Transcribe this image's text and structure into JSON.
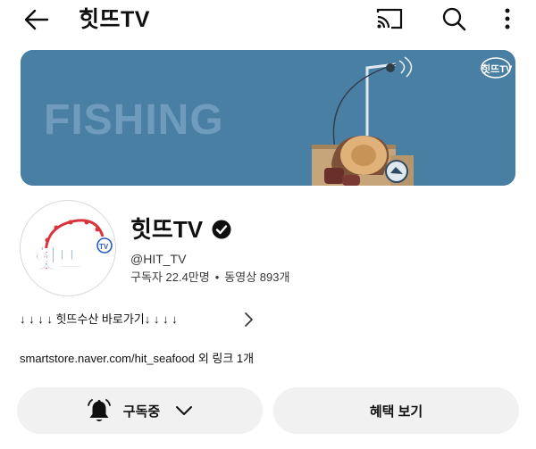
{
  "header": {
    "title": "힛뜨TV",
    "back_icon": "arrow-left-icon",
    "cast_icon": "cast-icon",
    "search_icon": "search-icon",
    "more_icon": "more-vertical-icon"
  },
  "banner": {
    "text": "FISHING",
    "logo_text": "힛뜨TV",
    "background_color": "#4a7fa4"
  },
  "channel": {
    "name": "힛뜨TV",
    "verified_icon": "verified-check-icon",
    "handle": "@HIT_TV",
    "subscribers": "구독자 22.4만명",
    "separator": "•",
    "videos": "동영상 893개",
    "avatar_text": "힛뜨",
    "avatar_badge": "TV"
  },
  "description": {
    "text": "↓ ↓ ↓ ↓ 힛뜨수산 바로가기↓ ↓ ↓ ↓",
    "chevron_icon": "chevron-right-icon"
  },
  "links": {
    "url": "smartstore.naver.com/hit_seafood",
    "more": "외 링크 1개"
  },
  "actions": {
    "subscribe_label": "구독중",
    "subscribe_icon": "bell-icon",
    "subscribe_chevron": "chevron-down-icon",
    "benefits_label": "혜택 보기"
  }
}
